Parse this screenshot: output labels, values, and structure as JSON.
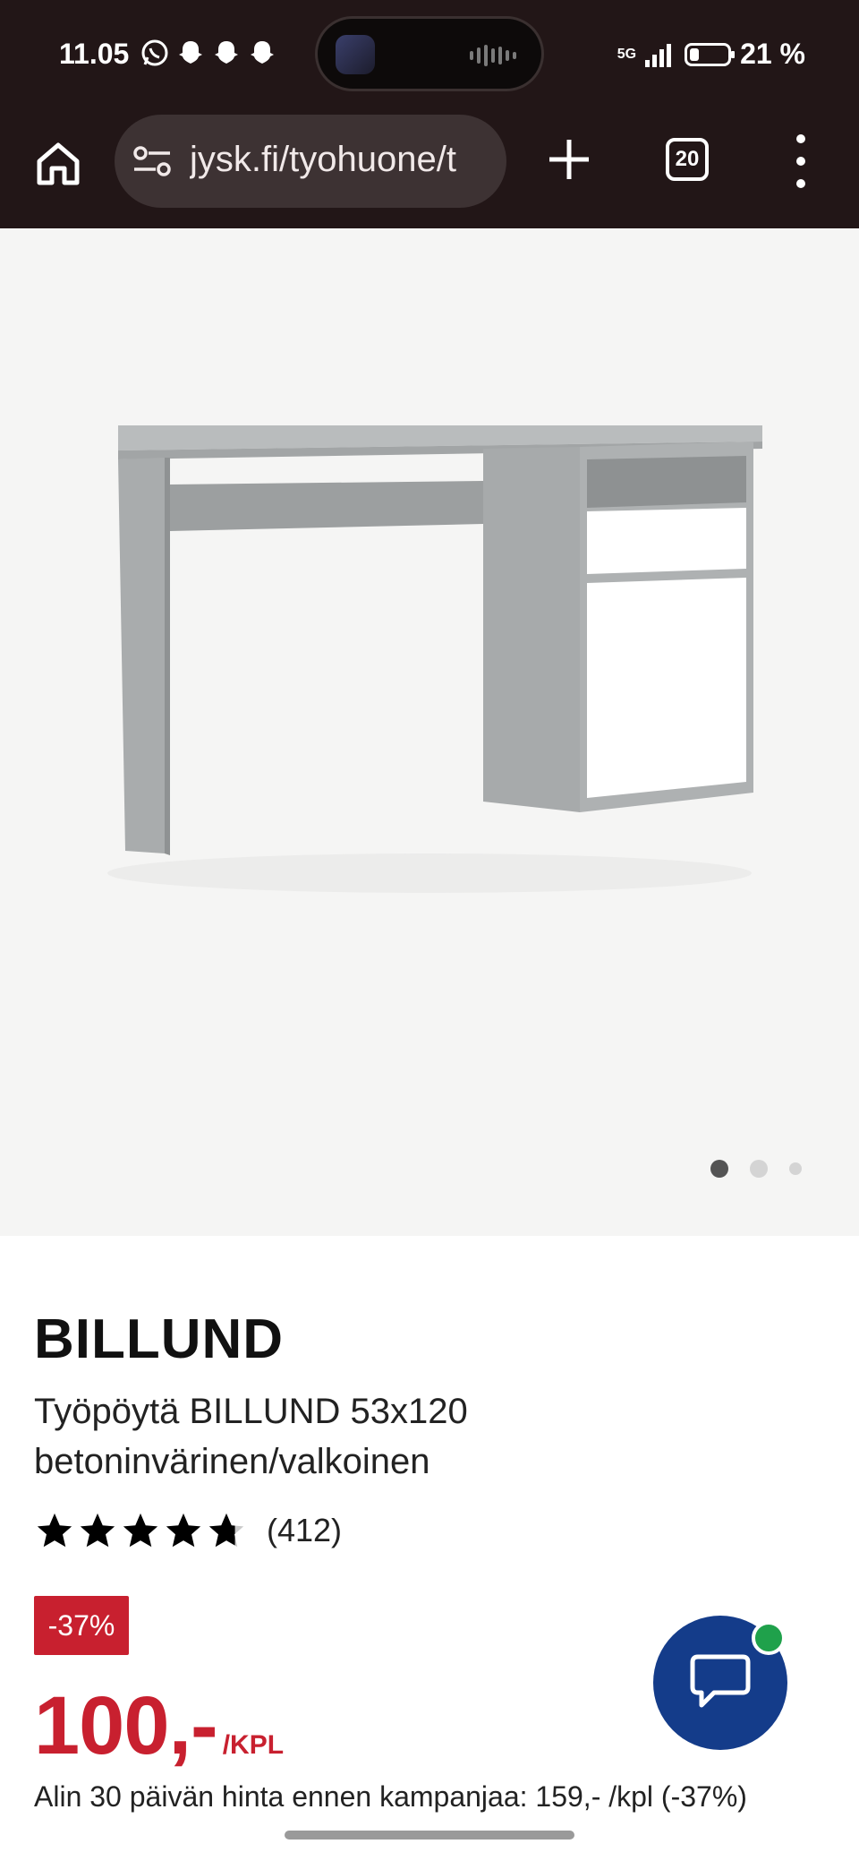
{
  "status_bar": {
    "time": "11.05",
    "network": "5G",
    "battery": "21 %"
  },
  "browser": {
    "url": "jysk.fi/tyohuone/t",
    "tab_count": "20"
  },
  "gallery": {
    "image_count": 3,
    "active_index": 0
  },
  "product": {
    "brand": "BILLUND",
    "description": "Työpöytä BILLUND 53x120 betoninvärinen/valkoinen",
    "rating": 4.7,
    "review_count": "(412)",
    "discount_badge": "-37%",
    "price": "100,-",
    "price_unit": "/KPL",
    "previous_price_text": "Alin 30 päivän hinta ennen kampanjaa: 159,- /kpl (-37%)"
  },
  "colors": {
    "accent_red": "#c8202f",
    "chat_blue": "#143c8a",
    "online_green": "#1fa14b",
    "browser_bar": "#221617"
  }
}
